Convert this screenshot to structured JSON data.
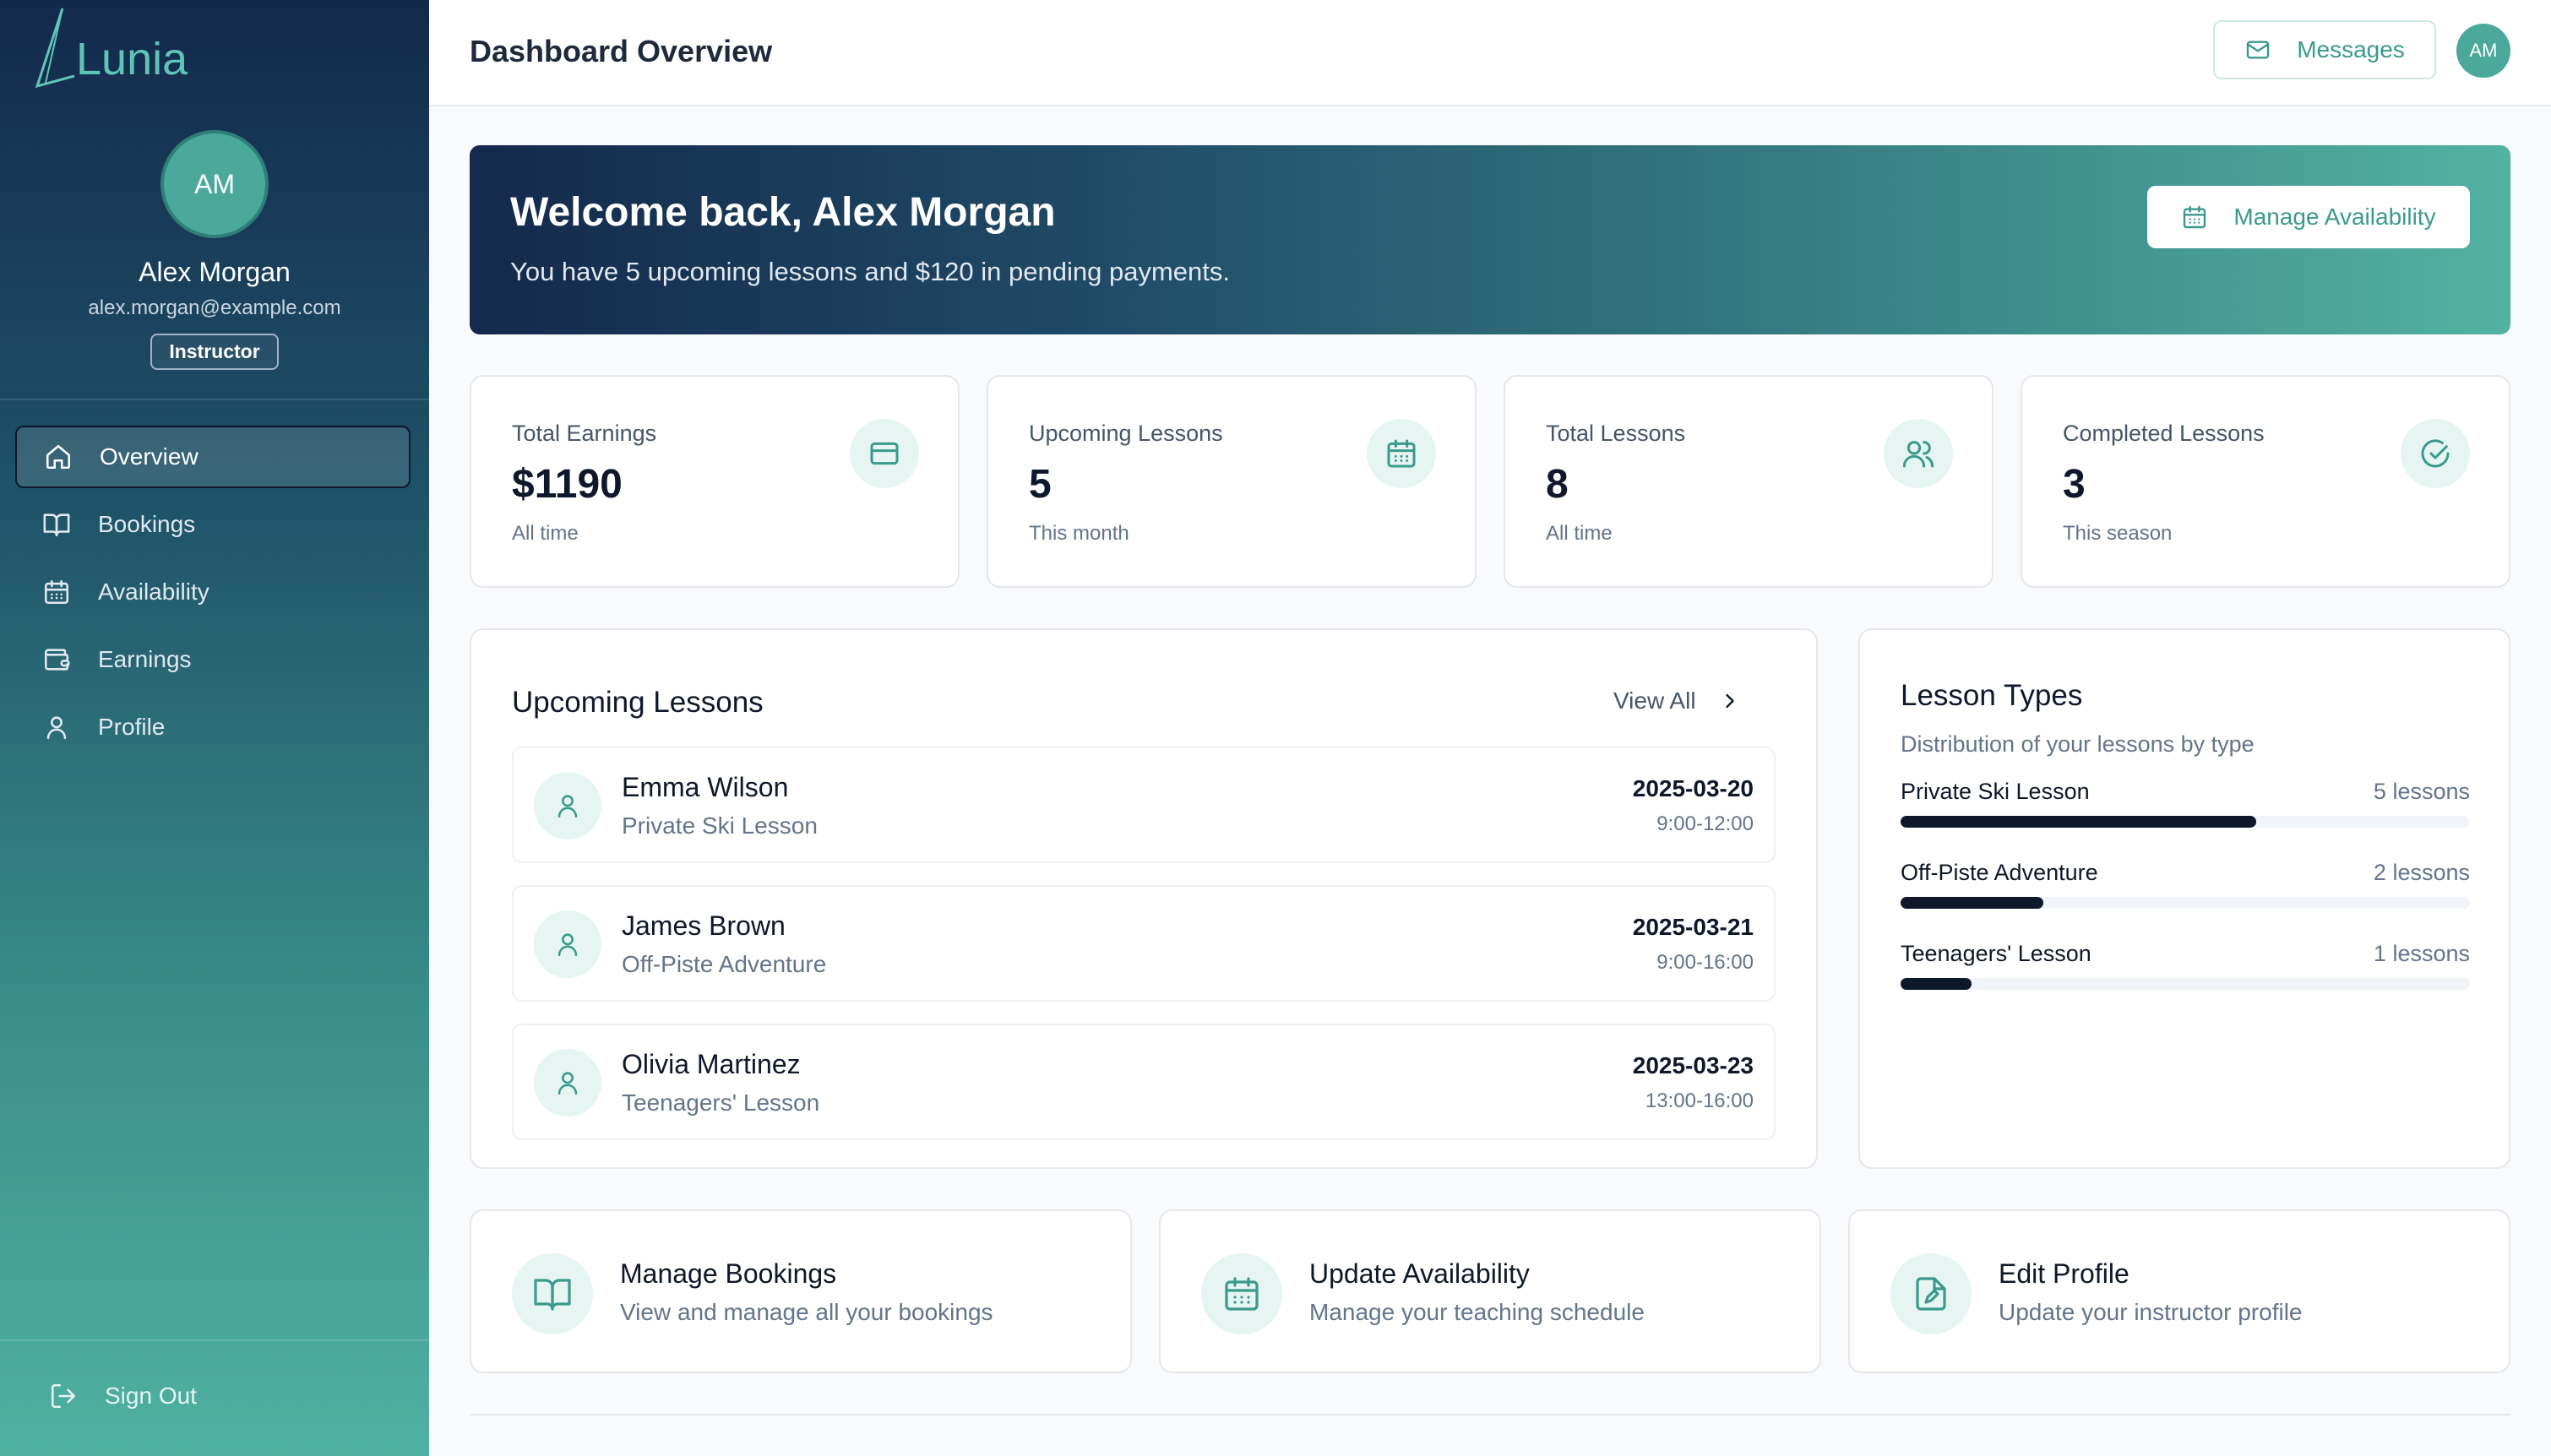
{
  "app": {
    "logo_text": "Lunia"
  },
  "sidebar": {
    "profile": {
      "initials": "AM",
      "name": "Alex Morgan",
      "email": "alex.morgan@example.com",
      "role_badge": "Instructor"
    },
    "nav": [
      {
        "label": "Overview",
        "icon": "home-icon",
        "active": true
      },
      {
        "label": "Bookings",
        "icon": "book-open-icon",
        "active": false
      },
      {
        "label": "Availability",
        "icon": "calendar-icon",
        "active": false
      },
      {
        "label": "Earnings",
        "icon": "wallet-icon",
        "active": false
      },
      {
        "label": "Profile",
        "icon": "user-icon",
        "active": false
      }
    ],
    "signout_label": "Sign Out"
  },
  "header": {
    "title": "Dashboard Overview",
    "messages_label": "Messages",
    "avatar_initials": "AM"
  },
  "banner": {
    "title": "Welcome back, Alex Morgan",
    "subtitle": "You have 5 upcoming lessons and $120 in pending payments.",
    "button_label": "Manage Availability"
  },
  "stats": [
    {
      "label": "Total Earnings",
      "value": "$1190",
      "note": "All time",
      "icon": "credit-card-icon"
    },
    {
      "label": "Upcoming Lessons",
      "value": "5",
      "note": "This month",
      "icon": "calendar-icon"
    },
    {
      "label": "Total Lessons",
      "value": "8",
      "note": "All time",
      "icon": "users-icon"
    },
    {
      "label": "Completed Lessons",
      "value": "3",
      "note": "This season",
      "icon": "check-circle-icon"
    }
  ],
  "upcoming": {
    "title": "Upcoming Lessons",
    "view_all_label": "View All",
    "lessons": [
      {
        "name": "Emma Wilson",
        "type": "Private Ski Lesson",
        "date": "2025-03-20",
        "time": "9:00-12:00"
      },
      {
        "name": "James Brown",
        "type": "Off-Piste Adventure",
        "date": "2025-03-21",
        "time": "9:00-16:00"
      },
      {
        "name": "Olivia Martinez",
        "type": "Teenagers' Lesson",
        "date": "2025-03-23",
        "time": "13:00-16:00"
      }
    ]
  },
  "lesson_types": {
    "title": "Lesson Types",
    "subtitle": "Distribution of your lessons by type",
    "items": [
      {
        "name": "Private Ski Lesson",
        "count_label": "5 lessons",
        "fraction": 0.625
      },
      {
        "name": "Off-Piste Adventure",
        "count_label": "2 lessons",
        "fraction": 0.25
      },
      {
        "name": "Teenagers' Lesson",
        "count_label": "1 lessons",
        "fraction": 0.125
      }
    ]
  },
  "actions": [
    {
      "title": "Manage Bookings",
      "subtitle": "View and manage all your bookings",
      "icon": "book-open-icon"
    },
    {
      "title": "Update Availability",
      "subtitle": "Manage your teaching schedule",
      "icon": "calendar-icon"
    },
    {
      "title": "Edit Profile",
      "subtitle": "Update your instructor profile",
      "icon": "file-edit-icon"
    }
  ],
  "colors": {
    "accent": "#3a9a8c",
    "sidebar_top": "#13294b",
    "sidebar_bottom": "#4fb1a1",
    "bar": "#0f172a"
  }
}
